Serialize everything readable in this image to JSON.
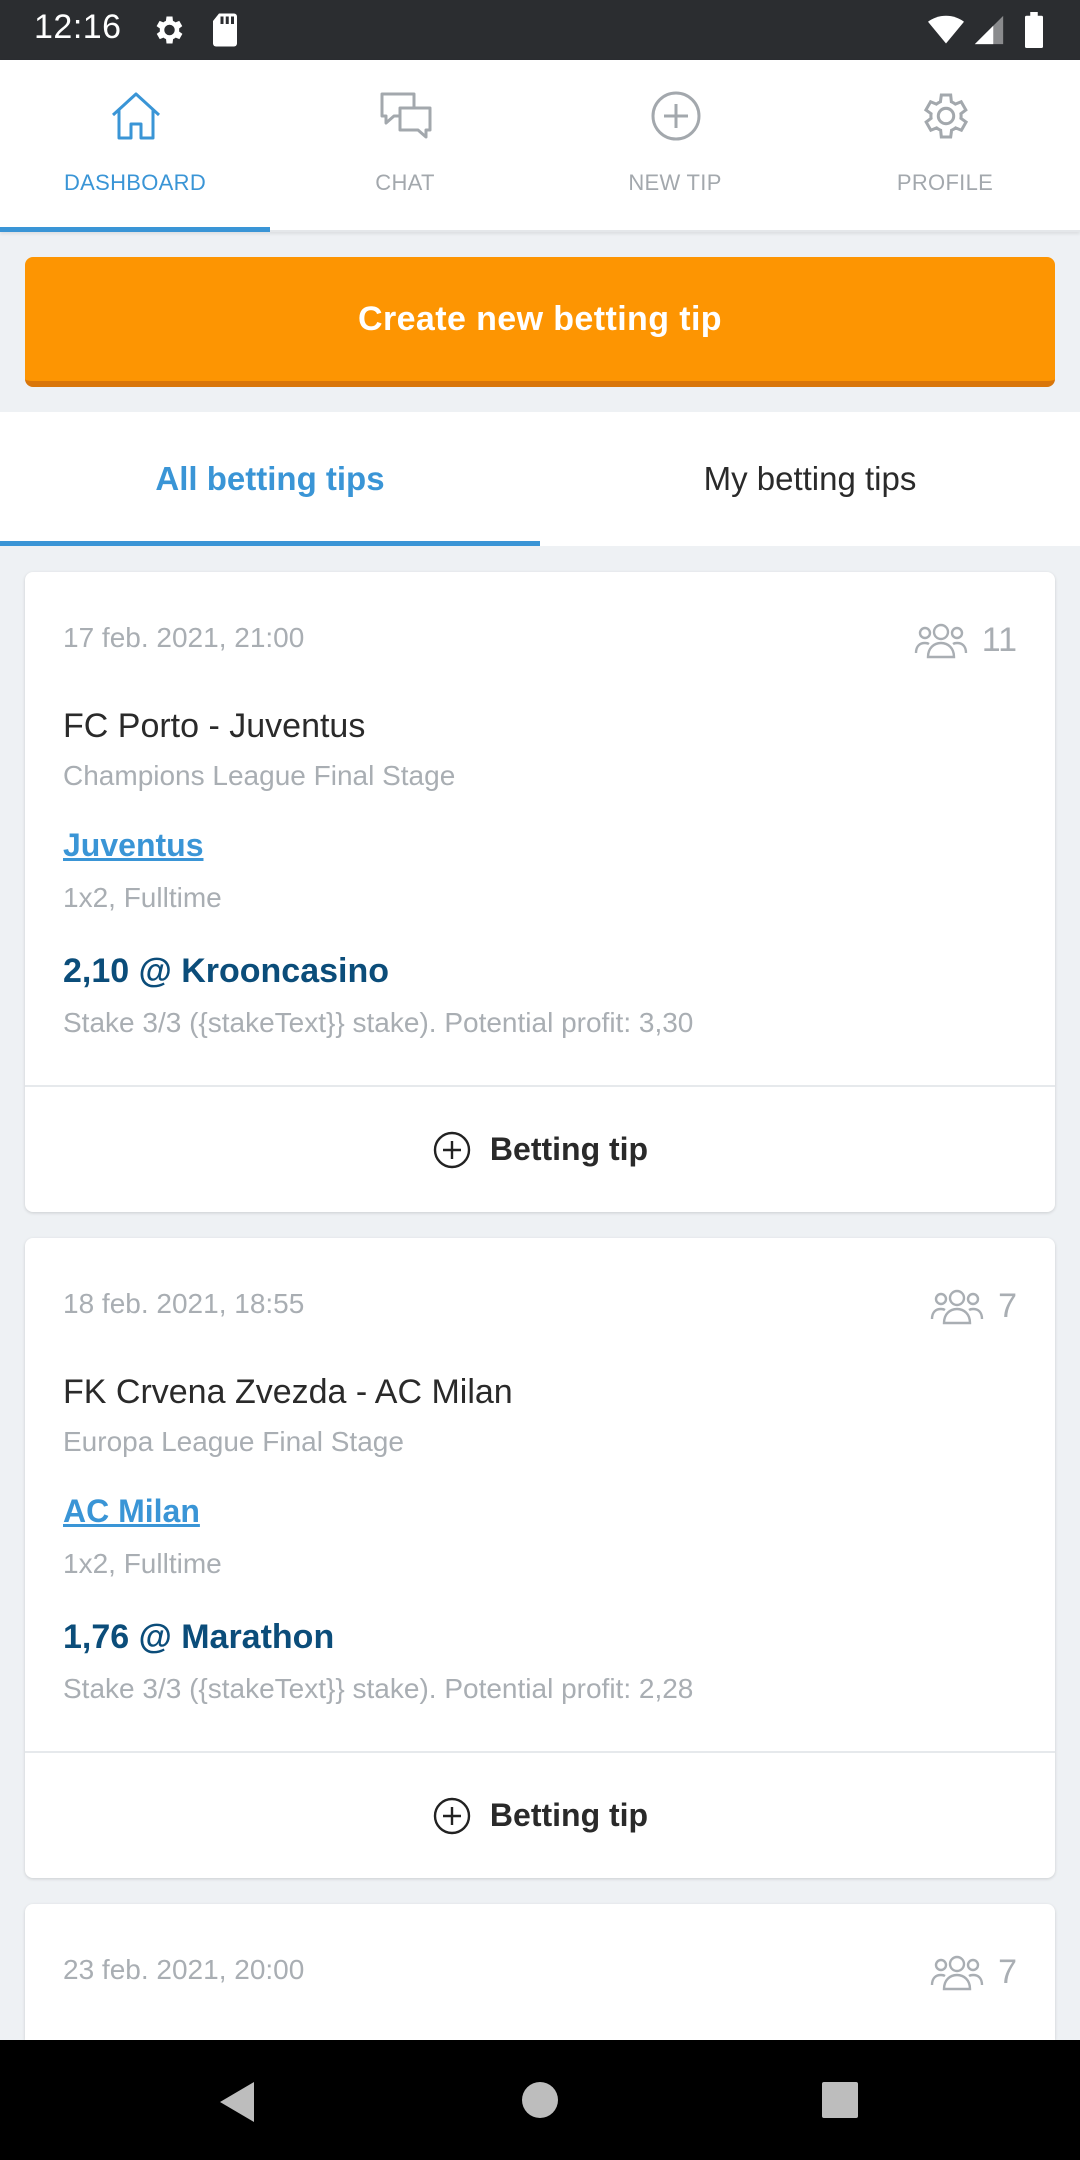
{
  "status_bar": {
    "time": "12:16"
  },
  "top_nav": {
    "items": [
      {
        "label": "DASHBOARD",
        "icon": "home-icon",
        "active": true
      },
      {
        "label": "CHAT",
        "icon": "chat-icon",
        "active": false
      },
      {
        "label": "NEW TIP",
        "icon": "plus-circle-icon",
        "active": false
      },
      {
        "label": "PROFILE",
        "icon": "gear-icon",
        "active": false
      }
    ]
  },
  "create_button": {
    "label": "Create new betting tip",
    "color": "#fd9502"
  },
  "tabs": [
    {
      "label": "All betting tips",
      "active": true
    },
    {
      "label": "My betting tips",
      "active": false
    }
  ],
  "tips": [
    {
      "date": "17 feb. 2021, 21:00",
      "followers": "11",
      "match": "FC Porto - Juventus",
      "league": "Champions League Final Stage",
      "pick": "Juventus",
      "market": "1x2, Fulltime",
      "odds": "2,10 @ Krooncasino",
      "stake": "Stake 3/3 ({stakeText}} stake). Potential profit: 3,30",
      "button_label": "Betting tip"
    },
    {
      "date": "18 feb. 2021, 18:55",
      "followers": "7",
      "match": "FK Crvena Zvezda - AC Milan",
      "league": "Europa League Final Stage",
      "pick": "AC Milan",
      "market": "1x2, Fulltime",
      "odds": "1,76 @ Marathon",
      "stake": "Stake 3/3 ({stakeText}} stake). Potential profit: 2,28",
      "button_label": "Betting tip"
    },
    {
      "date": "23 feb. 2021, 20:00",
      "followers": "7"
    }
  ],
  "colors": {
    "accent": "#3a95d6",
    "odds": "#0b4d7a",
    "muted": "#a9aeb3"
  }
}
